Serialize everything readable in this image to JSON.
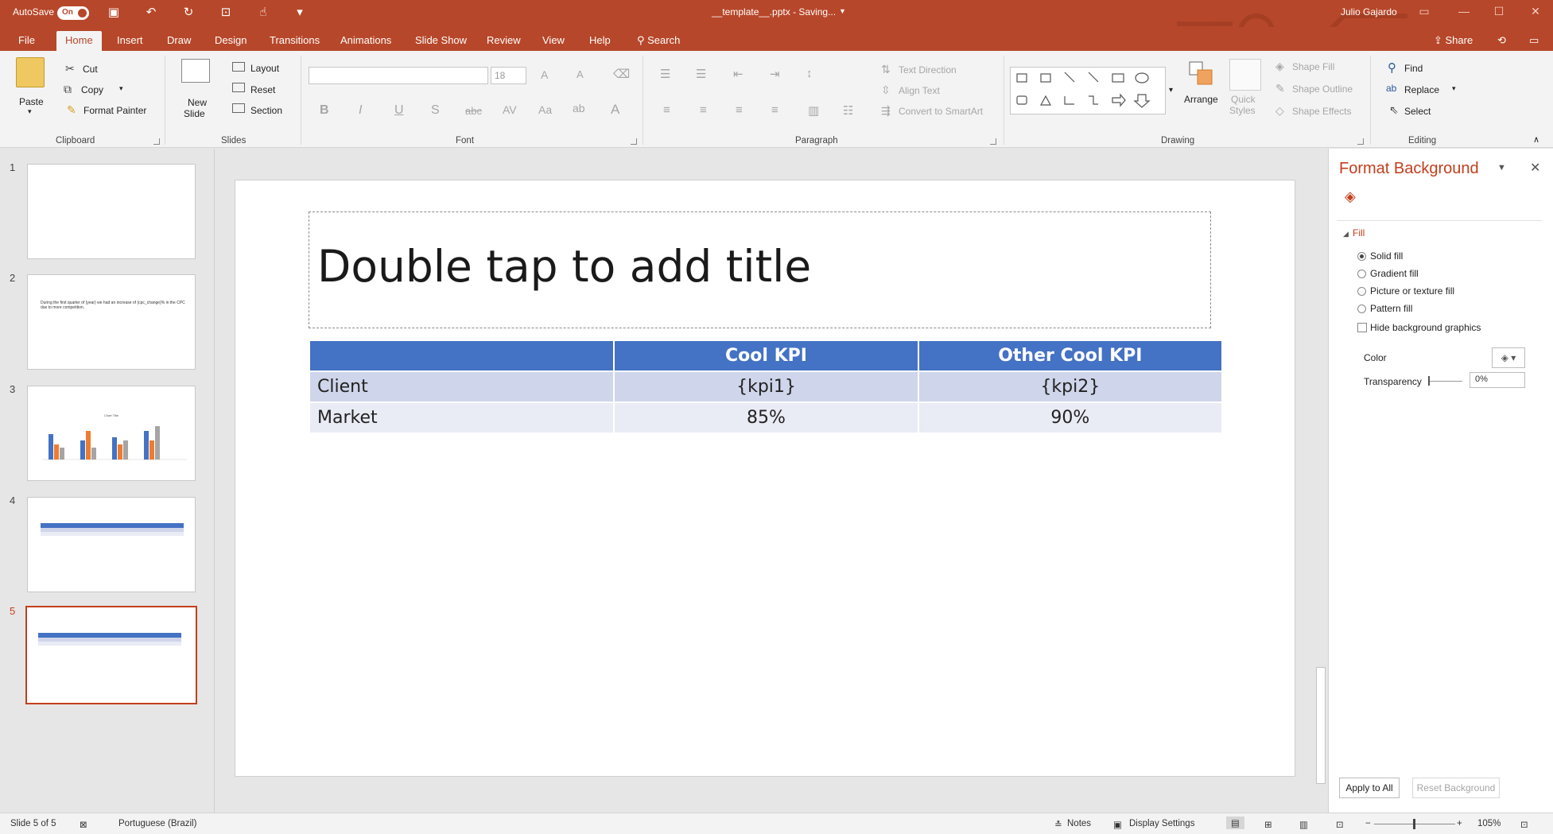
{
  "titlebar": {
    "autosave_label": "AutoSave",
    "autosave_state": "On",
    "document_title": "__template__.pptx - Saving...",
    "user_name": "Julio Gajardo"
  },
  "tabs": [
    "File",
    "Home",
    "Insert",
    "Draw",
    "Design",
    "Transitions",
    "Animations",
    "Slide Show",
    "Review",
    "View",
    "Help"
  ],
  "search_label": "Search",
  "share_label": "Share",
  "ribbon": {
    "clipboard": {
      "paste": "Paste",
      "cut": "Cut",
      "copy": "Copy",
      "format_painter": "Format Painter",
      "label": "Clipboard"
    },
    "slides": {
      "new_slide": "New",
      "new_slide2": "Slide",
      "layout": "Layout",
      "reset": "Reset",
      "section": "Section",
      "label": "Slides"
    },
    "font": {
      "font_name": "",
      "font_size": "18",
      "label": "Font"
    },
    "paragraph": {
      "text_direction": "Text Direction",
      "align_text": "Align Text",
      "convert_smartart": "Convert to SmartArt",
      "label": "Paragraph"
    },
    "drawing": {
      "arrange": "Arrange",
      "quick_styles": "Quick",
      "quick_styles2": "Styles",
      "shape_fill": "Shape Fill",
      "shape_outline": "Shape Outline",
      "shape_effects": "Shape Effects",
      "label": "Drawing"
    },
    "editing": {
      "find": "Find",
      "replace": "Replace",
      "select": "Select",
      "label": "Editing"
    }
  },
  "thumbnails": [
    {
      "num": "1",
      "text": ""
    },
    {
      "num": "2",
      "text": "During the first quarter of {year} we had an increase of {cpc_change}% in the CPC due to more competition."
    },
    {
      "num": "3",
      "text": "Chart Title"
    },
    {
      "num": "4",
      "text": ""
    },
    {
      "num": "5",
      "text": ""
    }
  ],
  "slide": {
    "title_placeholder": "Double tap to add title",
    "table": {
      "headers": [
        "",
        "Cool KPI",
        "Other Cool KPI"
      ],
      "rows": [
        [
          "Client",
          "{kpi1}",
          "{kpi2}"
        ],
        [
          "Market",
          "85%",
          "90%"
        ]
      ]
    }
  },
  "format_pane": {
    "title": "Format Background",
    "section": "Fill",
    "options": [
      "Solid fill",
      "Gradient fill",
      "Picture or texture fill",
      "Pattern fill"
    ],
    "selected_option": "Solid fill",
    "hide_graphics": "Hide background graphics",
    "color_label": "Color",
    "transparency_label": "Transparency",
    "transparency_value": "0%",
    "apply_all": "Apply to All",
    "reset_background": "Reset Background"
  },
  "statusbar": {
    "slide_info": "Slide 5 of 5",
    "language": "Portuguese (Brazil)",
    "notes": "Notes",
    "display_settings": "Display Settings",
    "zoom": "105%"
  },
  "colors": {
    "accent": "#b7472a",
    "table_header": "#4472c4",
    "row1": "#cfd5ea",
    "row2": "#e9ebf5"
  }
}
